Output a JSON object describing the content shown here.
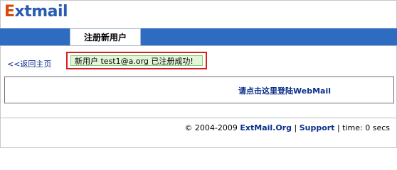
{
  "logo": {
    "first": "E",
    "rest": "xtmail"
  },
  "tab": {
    "label": "注册新用户"
  },
  "back_link": "<<返回主页",
  "message": "新用户 test1@a.org 已注册成功!",
  "login_link": "请点击这里登陆WebMail",
  "footer": {
    "copyright": "© 2004-2009",
    "brand": "ExtMail.Org",
    "separator1": "|",
    "support": "Support",
    "separator2": "|",
    "time": "time: 0 secs"
  },
  "colors": {
    "topbar": "#2d6cc0",
    "message_bg": "#e4f6d8",
    "highlight_border": "#d81e1e",
    "link": "#0a2f8a"
  }
}
